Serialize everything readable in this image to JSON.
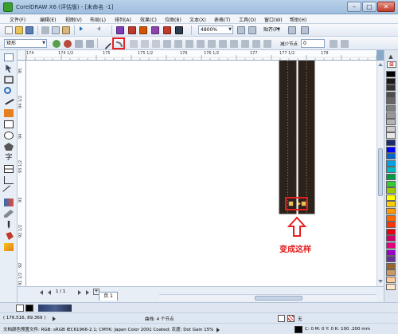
{
  "window": {
    "title": "CorelDRAW X6 (评估版) - [未命名 -1]",
    "btn_min": "–",
    "btn_max": "□",
    "btn_close": "✕"
  },
  "menu": [
    "文件(F)",
    "编辑(E)",
    "视图(V)",
    "布局(L)",
    "排列(A)",
    "效果(C)",
    "位图(B)",
    "文本(X)",
    "表格(T)",
    "工具(O)",
    "窗口(W)",
    "帮助(H)"
  ],
  "toolbar": {
    "zoom": "4800%",
    "snap": "贴齐(P)"
  },
  "propbar": {
    "shape_type": "矩形",
    "reduce_nodes": "减少节点",
    "reduce_value": "0"
  },
  "ruler_h": [
    "174",
    "174 1/2",
    "175",
    "175 1/2",
    "176",
    "176 1/2",
    "177",
    "177 1/2",
    "178"
  ],
  "ruler_v": [
    "95",
    "94 1/2",
    "94",
    "93 1/2",
    "93",
    "92 1/2",
    "92",
    "91 1/2"
  ],
  "docnav": {
    "page_count": "1 / 1",
    "page_tab": "页 1"
  },
  "status": {
    "coords": "( 176.516, 89.369 )",
    "curve": "曲线: 4 个节点",
    "fill": "无",
    "profile": "文档颜色预置文件: RGB: sRGB IEC61966-2.1; CMYK: Japan Color 2001 Coated; 灰度: Dot Gain 15%",
    "outline": "C: 0 M: 0 Y: 0 K: 100  .200 mm"
  },
  "annotation": {
    "label": "变成这样"
  },
  "colors": {
    "shape_fill": "#2b221b",
    "shape_outline": "#d9a064",
    "highlight": "#e62020"
  },
  "icons": [
    "pick-tool-icon",
    "shape-tool-icon",
    "crop-tool-icon",
    "zoom-tool-icon",
    "freehand-tool-icon",
    "smart-fill-icon",
    "rectangle-tool-icon",
    "ellipse-tool-icon",
    "polygon-tool-icon",
    "text-tool-icon",
    "table-tool-icon",
    "dimension-tool-icon",
    "connector-tool-icon",
    "blend-tool-icon",
    "eyedropper-tool-icon",
    "outline-pen-icon",
    "fill-tool-icon",
    "interactive-fill-icon"
  ]
}
